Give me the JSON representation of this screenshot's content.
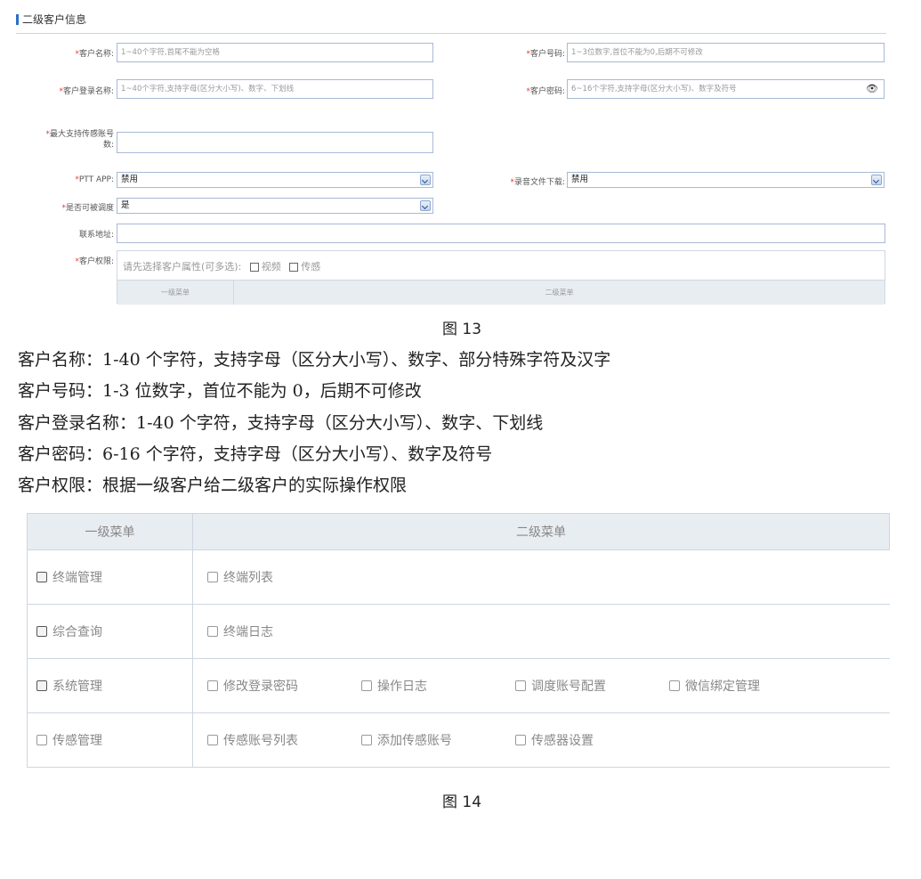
{
  "form": {
    "section_title": "二级客户信息",
    "fields": {
      "customer_name": {
        "label": "客户名称:",
        "placeholder": "1~40个字符,首尾不能为空格"
      },
      "customer_number": {
        "label": "客户号码:",
        "placeholder": "1~3位数字,首位不能为0,后期不可修改"
      },
      "login_name": {
        "label": "客户登录名称:",
        "placeholder": "1~40个字符,支持字母(区分大小写)、数字、下划线"
      },
      "password": {
        "label": "客户密码:",
        "placeholder": "6~16个字符,支持字母(区分大小写)、数字及符号"
      },
      "max_sensor_line1": "最大支持传感账号",
      "max_sensor_line2": "数:",
      "ptt_app": {
        "label": "PTT APP:",
        "value": "禁用"
      },
      "record_download": {
        "label": "录音文件下载:",
        "value": "禁用"
      },
      "dispatchable": {
        "label": "是否可被调度",
        "value": "是"
      },
      "address": {
        "label": "联系地址:"
      },
      "permission": {
        "label": "客户权限:",
        "hint": "请先选择客户属性(可多选):",
        "options": [
          "视频",
          "传感"
        ],
        "col1": "一级菜单",
        "col2": "二级菜单"
      }
    }
  },
  "caption13": "图 13",
  "paragraphs": [
    "客户名称：1-40 个字符，支持字母（区分大小写）、数字、部分特殊字符及汉字",
    "客户号码：1-3 位数字，首位不能为 0，后期不可修改",
    "客户登录名称：1-40 个字符，支持字母（区分大小写）、数字、下划线",
    "客户密码：6-16 个字符，支持字母（区分大小写）、数字及符号",
    "客户权限：根据一级客户给二级客户的实际操作权限"
  ],
  "table": {
    "headers": [
      "一级菜单",
      "二级菜单"
    ],
    "rows": [
      {
        "menu": "终端管理",
        "items": [
          "终端列表"
        ]
      },
      {
        "menu": "综合查询",
        "items": [
          "终端日志"
        ]
      },
      {
        "menu": "系统管理",
        "items": [
          "修改登录密码",
          "操作日志",
          "调度账号配置",
          "微信绑定管理"
        ]
      },
      {
        "menu": "传感管理",
        "items": [
          "传感账号列表",
          "添加传感账号",
          "传感器设置"
        ]
      }
    ]
  },
  "caption14": "图 14"
}
